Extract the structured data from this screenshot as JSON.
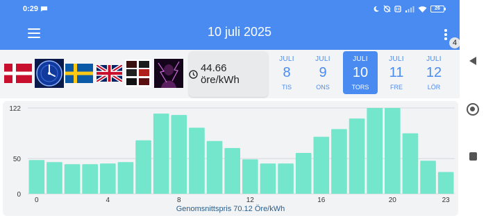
{
  "status": {
    "time": "0:29",
    "battery": "26"
  },
  "header": {
    "title": "10 juli 2025",
    "badge": "4"
  },
  "price": {
    "text": "44.66 öre/kWh"
  },
  "days": [
    {
      "month": "JULI",
      "num": "8",
      "weekday": "TIS",
      "selected": false
    },
    {
      "month": "JULI",
      "num": "9",
      "weekday": "ONS",
      "selected": false
    },
    {
      "month": "JULI",
      "num": "10",
      "weekday": "TORS",
      "selected": true
    },
    {
      "month": "JULI",
      "num": "11",
      "weekday": "FRE",
      "selected": false
    },
    {
      "month": "JULI",
      "num": "12",
      "weekday": "LÖR",
      "selected": false
    }
  ],
  "chart_data": {
    "type": "bar",
    "categories": [
      "0",
      "1",
      "2",
      "3",
      "4",
      "5",
      "6",
      "7",
      "8",
      "9",
      "10",
      "11",
      "12",
      "13",
      "14",
      "15",
      "16",
      "17",
      "18",
      "19",
      "20",
      "21",
      "22",
      "23"
    ],
    "values": [
      48,
      45,
      42,
      42,
      43,
      45,
      76,
      114,
      112,
      94,
      75,
      65,
      49,
      43,
      43,
      58,
      81,
      92,
      107,
      122,
      122,
      86,
      47,
      31
    ],
    "ylim": [
      0,
      122
    ],
    "yticks": [
      "0",
      "50",
      "122"
    ],
    "xticks": [
      "0",
      "4",
      "8",
      "12",
      "16",
      "20",
      "23"
    ],
    "caption": "Genomsnittspris 70.12 Öre/kWh",
    "bar_color": "#74e6cb",
    "grid": true
  },
  "colors": {
    "accent": "#4a8bf2",
    "bar": "#74e6cb"
  }
}
